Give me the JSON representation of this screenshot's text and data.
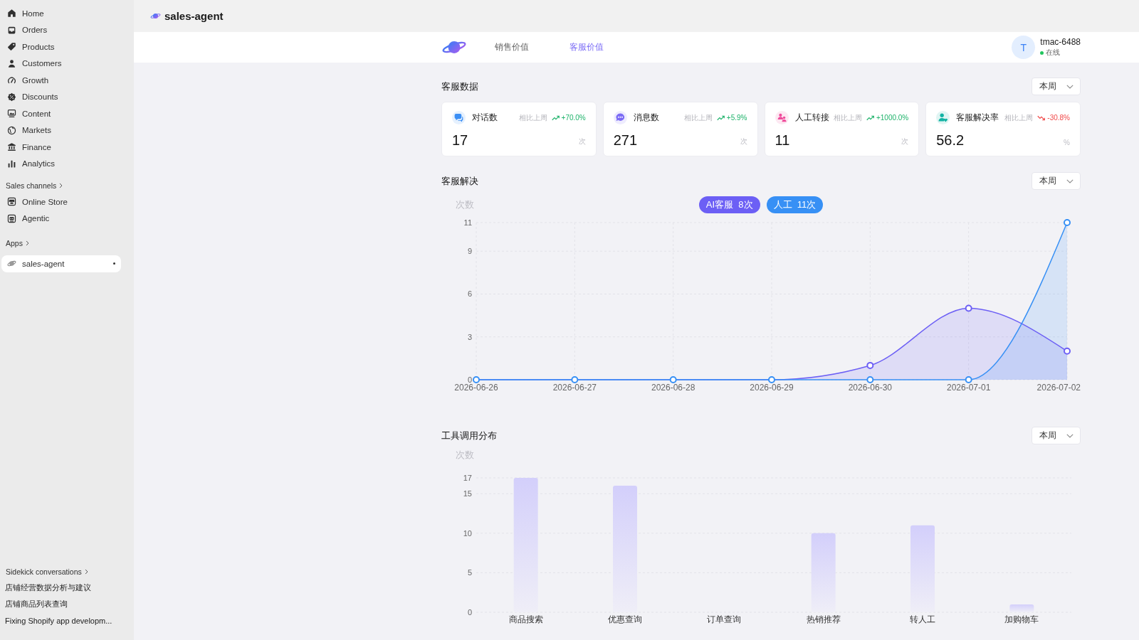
{
  "sidebar": {
    "nav": [
      {
        "label": "Home",
        "selected": false
      },
      {
        "label": "Orders",
        "selected": false
      },
      {
        "label": "Products",
        "selected": false
      },
      {
        "label": "Customers",
        "selected": false
      },
      {
        "label": "Growth",
        "selected": false
      },
      {
        "label": "Discounts",
        "selected": false
      },
      {
        "label": "Content",
        "selected": false
      },
      {
        "label": "Markets",
        "selected": false
      },
      {
        "label": "Finance",
        "selected": false
      },
      {
        "label": "Analytics",
        "selected": false
      }
    ],
    "sales_channels": {
      "title": "Sales channels",
      "items": [
        {
          "label": "Online Store",
          "selected": false
        },
        {
          "label": "Agentic",
          "selected": false
        }
      ]
    },
    "apps": {
      "title": "Apps",
      "items": [
        {
          "label": "sales-agent",
          "selected": true,
          "pinned": true
        }
      ]
    },
    "sidekick": {
      "title": "Sidekick conversations",
      "items": [
        {
          "label": "店铺经营数据分析与建议"
        },
        {
          "label": "店铺商品列表查询"
        },
        {
          "label": "Fixing Shopify app developm..."
        }
      ]
    }
  },
  "app_header": {
    "title": "sales-agent"
  },
  "top_bar": {
    "tabs": [
      {
        "label": "销售价值",
        "selected": false
      },
      {
        "label": "客服价值",
        "selected": true
      }
    ],
    "user": {
      "avatar": "T",
      "name": "tmac-6488",
      "status": "在线",
      "online": true
    }
  },
  "stats": {
    "title": "客服数据",
    "period": "本周",
    "cards": [
      {
        "label": "对话数",
        "color": "#3b8ff5",
        "compare_label": "相比上周",
        "rising": true,
        "delta": "+70.0%",
        "value": "17",
        "unit": "次"
      },
      {
        "label": "消息数",
        "color": "#7c6cf5",
        "compare_label": "相比上周",
        "rising": true,
        "delta": "+5.9%",
        "value": "271",
        "unit": "次"
      },
      {
        "label": "人工转接",
        "color": "#ef4b9b",
        "compare_label": "相比上周",
        "rising": true,
        "delta": "+1000.0%",
        "value": "11",
        "unit": "次"
      },
      {
        "label": "客服解决率",
        "color": "#13b3a4",
        "compare_label": "相比上周",
        "rising": false,
        "delta": "-30.8%",
        "value": "56.2",
        "unit": "%"
      }
    ]
  },
  "resolution": {
    "title": "客服解决",
    "period": "本周",
    "legend_counts": [
      "8次",
      "11次"
    ],
    "chart_data": {
      "type": "area",
      "ylabel": "次数",
      "categories": [
        "2026-06-26",
        "2026-06-27",
        "2026-06-28",
        "2026-06-29",
        "2026-06-30",
        "2026-07-01",
        "2026-07-02"
      ],
      "series": [
        {
          "name": "AI客服",
          "color": "#6c5ff5",
          "values": [
            0,
            0,
            0,
            0,
            1,
            5,
            2
          ]
        },
        {
          "name": "人工",
          "color": "#3790f5",
          "values": [
            0,
            0,
            0,
            0,
            0,
            0,
            11
          ]
        }
      ],
      "ylim": [
        0,
        11
      ],
      "yticks": [
        0,
        3,
        6,
        9,
        11
      ],
      "grid": true
    }
  },
  "tool_usage": {
    "title": "工具调用分布",
    "period": "本周",
    "chart_data": {
      "type": "bar",
      "ylabel": "次数",
      "categories": [
        "商品搜索",
        "优惠查询",
        "订单查询",
        "热销推荐",
        "转人工",
        "加购物车"
      ],
      "values": [
        17,
        16,
        0,
        10,
        11,
        1
      ],
      "ylim": [
        0,
        17
      ],
      "yticks": [
        0,
        5,
        10,
        15,
        17
      ],
      "grid": true
    }
  }
}
